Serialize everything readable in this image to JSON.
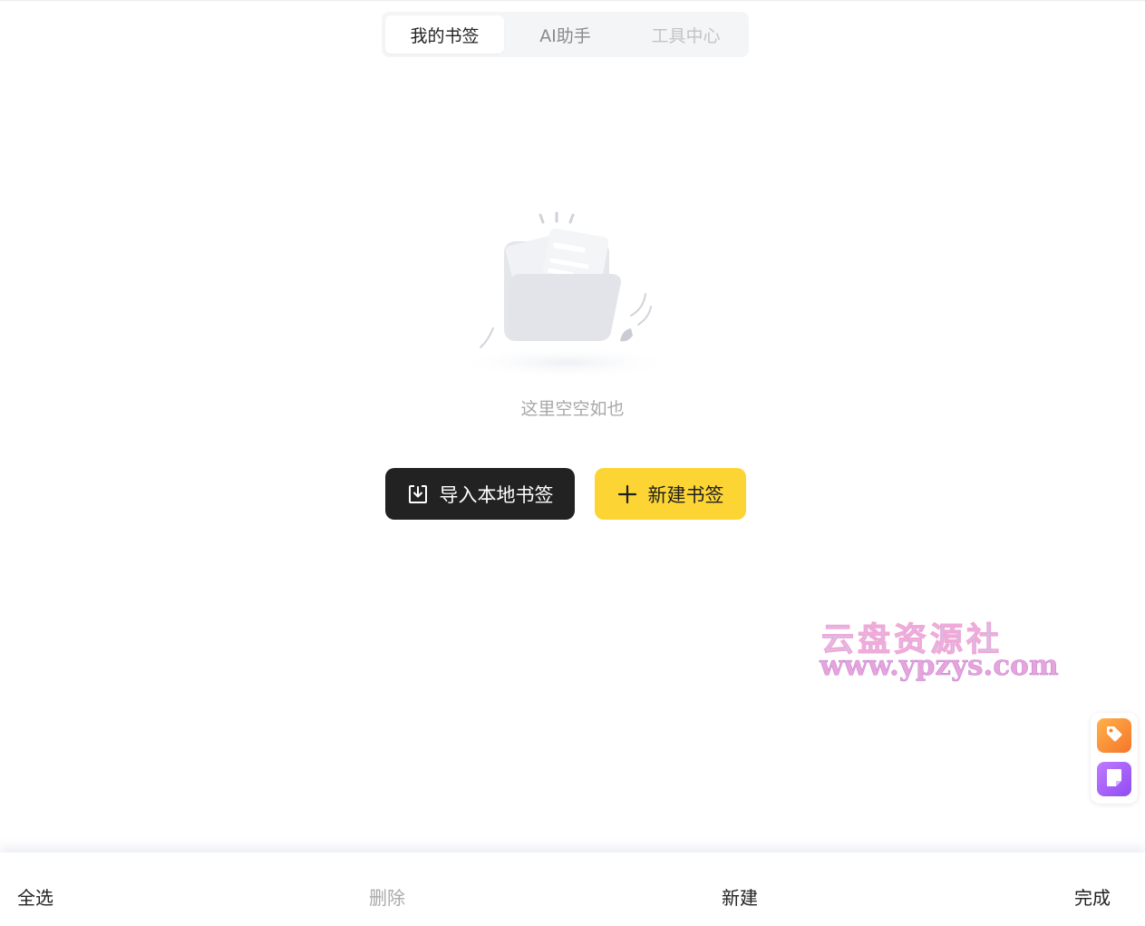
{
  "tabs": [
    {
      "label": "我的书签",
      "state": "active"
    },
    {
      "label": "AI助手",
      "state": "normal"
    },
    {
      "label": "工具中心",
      "state": "muted"
    }
  ],
  "empty_state": {
    "illustration": "empty-folder-illustration",
    "message": "这里空空如也"
  },
  "actions": {
    "import_label": "导入本地书签",
    "import_icon": "import-icon",
    "new_label": "新建书签",
    "new_icon": "plus-icon"
  },
  "watermark": {
    "line1": "云盘资源社",
    "line2": "www.ypzys.com"
  },
  "side_widget": {
    "items": [
      {
        "icon": "tag-icon",
        "color": "#f5862e"
      },
      {
        "icon": "note-icon",
        "color": "#a862f7"
      }
    ]
  },
  "bottom_bar": {
    "select_all": "全选",
    "delete": "删除",
    "new": "新建",
    "done": "完成"
  },
  "colors": {
    "primary_dark": "#222222",
    "accent_yellow": "#fcd535",
    "muted_text": "#a8a8a8"
  }
}
